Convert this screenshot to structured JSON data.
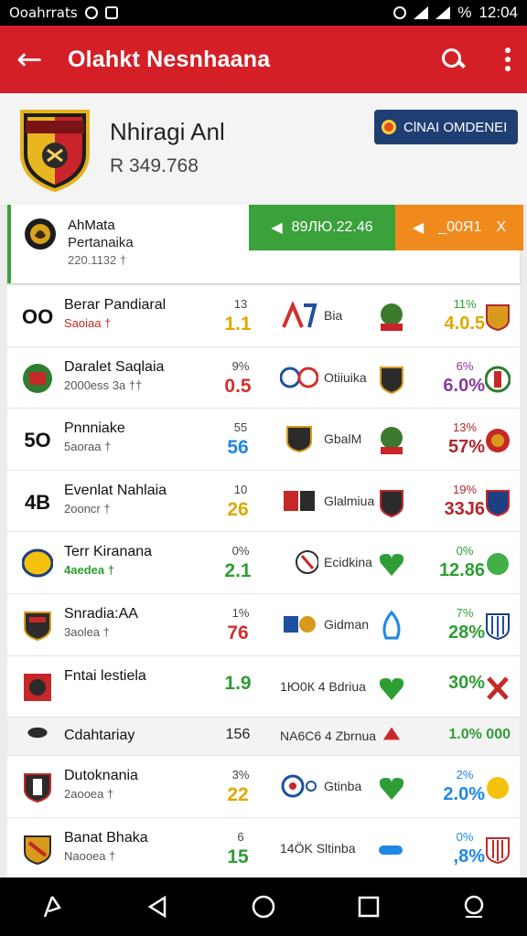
{
  "status_bar": {
    "carrier": "Ooahrrats",
    "time": "12:04",
    "battery": "%"
  },
  "app_bar": {
    "title": "Olahkt Nesnhaana"
  },
  "team": {
    "name": "Nhiragi Anl",
    "rank": "R 349.768",
    "follow_label": "ClNAI OMDENEI"
  },
  "featured": {
    "title": "AhMata",
    "subtitle": "Pertanaika",
    "meta": "220.1132 †",
    "live_label": "89ЛЮ.22.46",
    "odds_label": "_00Я1",
    "close_label": "X",
    "accent": "#38a33a"
  },
  "fixtures": [
    {
      "lead": "OO",
      "name": "Berar Pandiaral",
      "sub": "Saoiaa †",
      "sub_style": "red",
      "mid_top": "13",
      "mid_val": "1.1",
      "mid_color": "yel",
      "mid_text": "Bia",
      "pct_top": "11%",
      "pct_val": "4.0.5",
      "pct_color": "yel"
    },
    {
      "lead": "",
      "name": "Daralet Saqlaia",
      "sub": "2000ess 3a ††",
      "sub_style": "",
      "mid_top": "9%",
      "mid_val": "0.5",
      "mid_color": "red",
      "mid_text": "Otiiuika",
      "pct_top": "6%",
      "pct_val": "6.0%",
      "pct_color": "pur"
    },
    {
      "lead": "5O",
      "name": "Pnnniake",
      "sub": "5aoraa †",
      "sub_style": "",
      "mid_top": "55",
      "mid_val": "56",
      "mid_color": "blue",
      "mid_text": "GbalM",
      "pct_top": "13%",
      "pct_val": "57%",
      "pct_color": "dkred"
    },
    {
      "lead": "4B",
      "name": "Evenlat Nahlaia",
      "sub": "2ooncr †",
      "sub_style": "",
      "mid_top": "10",
      "mid_val": "26",
      "mid_color": "yel",
      "mid_text": "Glalmiua",
      "pct_top": "19%",
      "pct_val": "33J6",
      "pct_color": "dkred"
    },
    {
      "lead": "",
      "name": "Terr Kiranana",
      "sub": "4aedea †",
      "sub_style": "green",
      "mid_top": "0%",
      "mid_val": "2.1",
      "mid_color": "grn",
      "mid_text": "Ecidkina",
      "pct_top": "0%",
      "pct_val": "12.86",
      "pct_color": "grn"
    },
    {
      "lead": "",
      "name": "Snradia:AA",
      "sub": "3aolea †",
      "sub_style": "",
      "mid_top": "1%",
      "mid_val": "76",
      "mid_color": "red",
      "mid_text": "Gidman",
      "pct_top": "7%",
      "pct_val": "28%",
      "pct_color": "grn"
    },
    {
      "lead": "",
      "name": "Fntai lestiela",
      "sub": "",
      "sub_style": "",
      "mid_top": "",
      "mid_val": "1.9",
      "mid_color": "grn",
      "mid_text": "1Ю0К 4 Bdriua",
      "pct_top": "",
      "pct_val": "30%",
      "pct_color": "grn"
    },
    {
      "lead": "",
      "name": "Cdahtariay",
      "sub": "",
      "sub_style": "",
      "mid_top": "",
      "mid_val": "156",
      "mid_color": "",
      "mid_text": "NA6C6 4 Zbrnua",
      "pct_top": "",
      "pct_val": "1.0%  000",
      "pct_color": "grn"
    },
    {
      "lead": "",
      "name": "Dutoknania",
      "sub": "2aooea †",
      "sub_style": "",
      "mid_top": "3%",
      "mid_val": "22",
      "mid_color": "yel",
      "mid_text": "Gtinba",
      "pct_top": "2%",
      "pct_val": "2.0%",
      "pct_color": "blue"
    },
    {
      "lead": "",
      "name": "Banat Bhaka",
      "sub": "Naooea †",
      "sub_style": "",
      "mid_top": "6",
      "mid_val": "15",
      "mid_color": "grn",
      "mid_text": "14ÖK  Sltinba",
      "pct_top": "0%",
      "pct_val": ",8%",
      "pct_color": "blue"
    }
  ],
  "colors": {
    "app_bar": "#d41f26",
    "live": "#3aa13b",
    "odds": "#f08a1d",
    "follow": "#1f3f73"
  }
}
